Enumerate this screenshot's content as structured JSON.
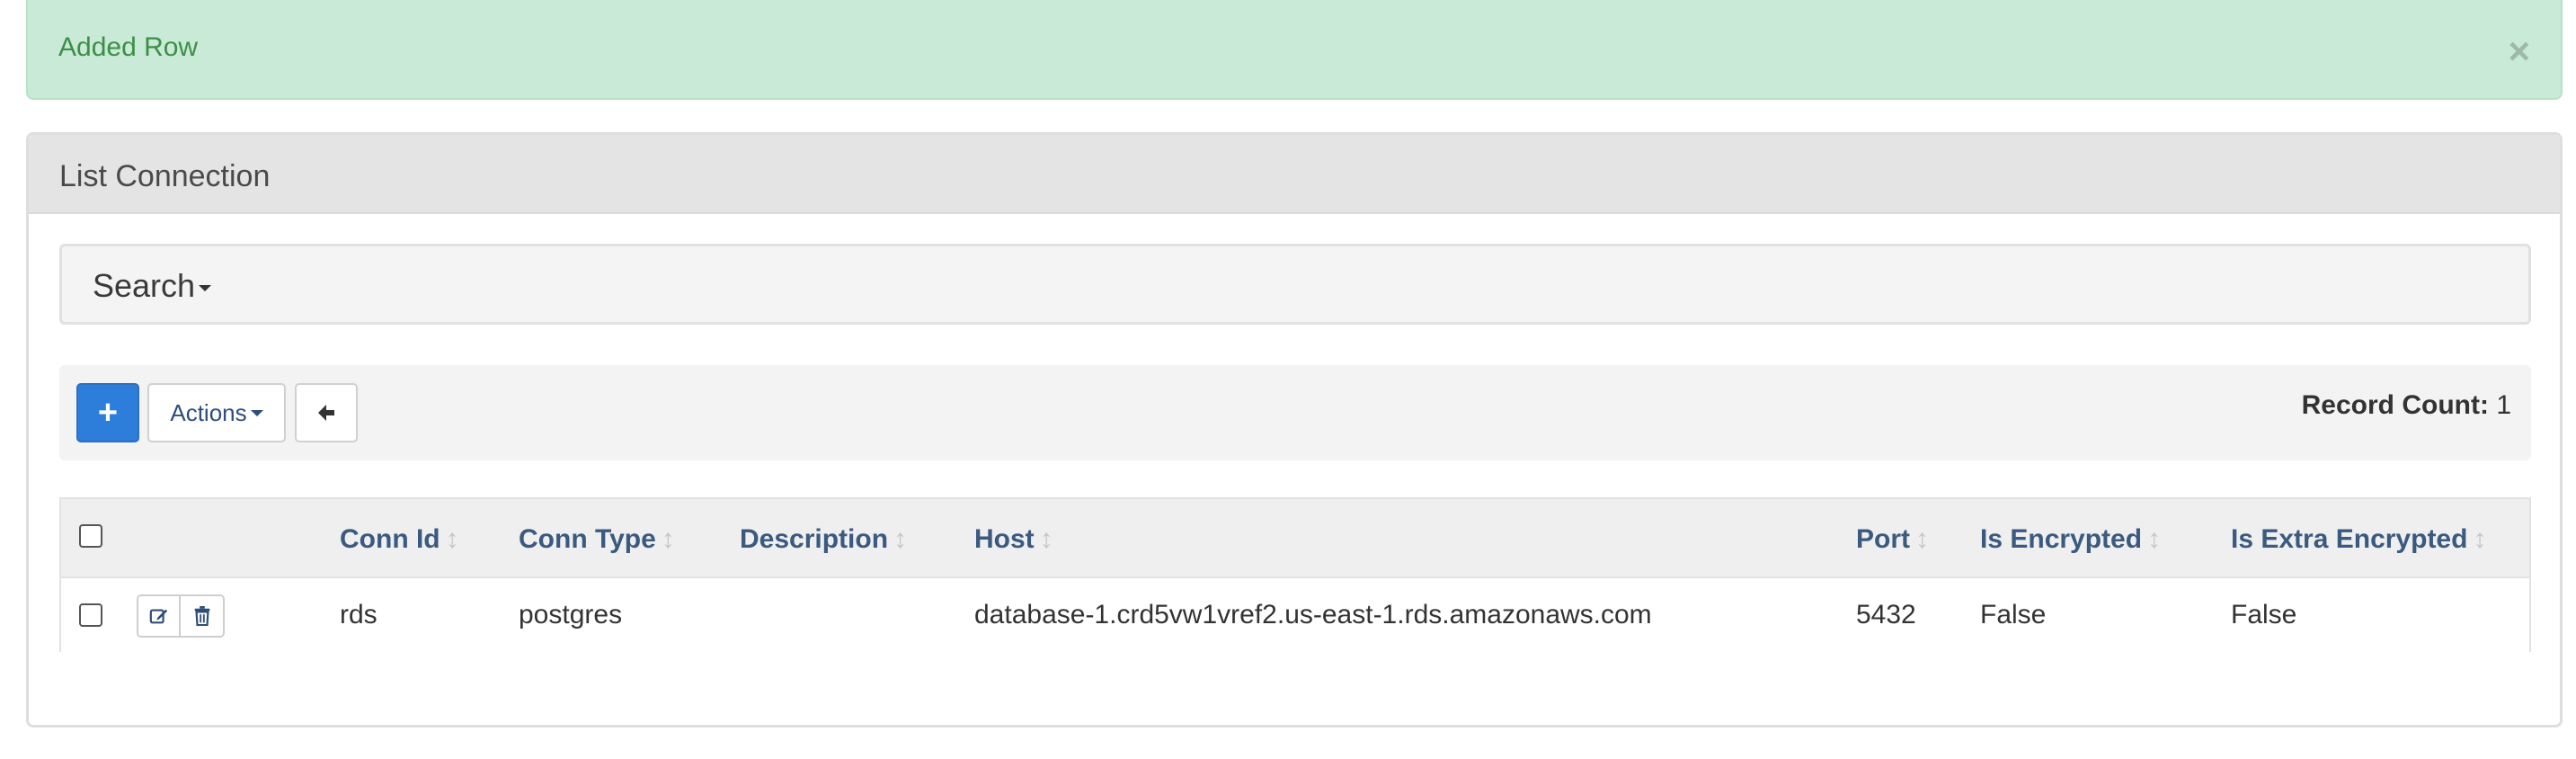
{
  "alert": {
    "message": "Added Row",
    "close_symbol": "×"
  },
  "panel": {
    "title": "List Connection"
  },
  "search": {
    "label": "Search"
  },
  "toolbar": {
    "add_symbol": "+",
    "actions_label": "Actions",
    "record_count_label": "Record Count:",
    "record_count_value": "1"
  },
  "table": {
    "columns": [
      "Conn Id",
      "Conn Type",
      "Description",
      "Host",
      "Port",
      "Is Encrypted",
      "Is Extra Encrypted"
    ],
    "sort_symbol": "↕",
    "rows": [
      {
        "conn_id": "rds",
        "conn_type": "postgres",
        "description": "",
        "host": "database-1.crd5vw1vref2.us-east-1.rds.amazonaws.com",
        "port": "5432",
        "is_encrypted": "False",
        "is_extra_encrypted": "False"
      }
    ]
  },
  "icons": {
    "close": "close-icon",
    "add": "plus-icon",
    "caret": "caret-down-icon",
    "back": "arrow-left-icon",
    "edit": "edit-icon",
    "delete": "trash-icon",
    "sort": "sort-icon"
  },
  "colors": {
    "alert_bg": "#c8ead6",
    "alert_text": "#3c8f48",
    "primary": "#2d7ddb",
    "header_text": "#3b5a80"
  }
}
